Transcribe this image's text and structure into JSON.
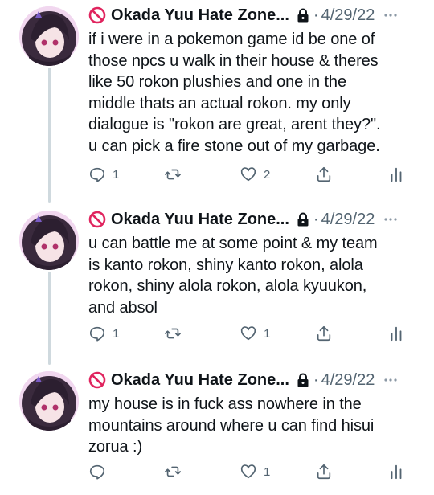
{
  "tweets": [
    {
      "name": "Okada Yuu Hate Zone...",
      "separator": "·",
      "date": "4/29/22",
      "text": "if i were in a pokemon game id be one of\nthose npcs u walk in their house & theres\nlike 50 rokon plushies and one in the\nmiddle thats an actual rokon. my only\ndialogue is \"rokon are great, arent they?\".\nu can pick a fire stone out of my garbage.",
      "replies": "1",
      "retweets": "",
      "likes": "2"
    },
    {
      "name": "Okada Yuu Hate Zone...",
      "separator": "·",
      "date": "4/29/22",
      "text": "u can battle me at some point & my team\nis kanto rokon, shiny kanto rokon, alola\nrokon, shiny alola rokon, alola kyuukon,\nand absol",
      "replies": "1",
      "retweets": "",
      "likes": "1"
    },
    {
      "name": "Okada Yuu Hate Zone...",
      "separator": "·",
      "date": "4/29/22",
      "text": "my house is in fuck ass nowhere in the\nmountains around where u can find hisui\nzorua :)",
      "replies": "",
      "retweets": "",
      "likes": "1"
    }
  ],
  "colors": {
    "text": "#0f1419",
    "secondary": "#536471",
    "thread_line": "#cfd9de",
    "no_entry_red": "#e0245e"
  },
  "icons": [
    "no-entry-icon",
    "lock-icon",
    "more-icon",
    "reply-icon",
    "retweet-icon",
    "like-icon",
    "share-icon",
    "analytics-icon"
  ]
}
